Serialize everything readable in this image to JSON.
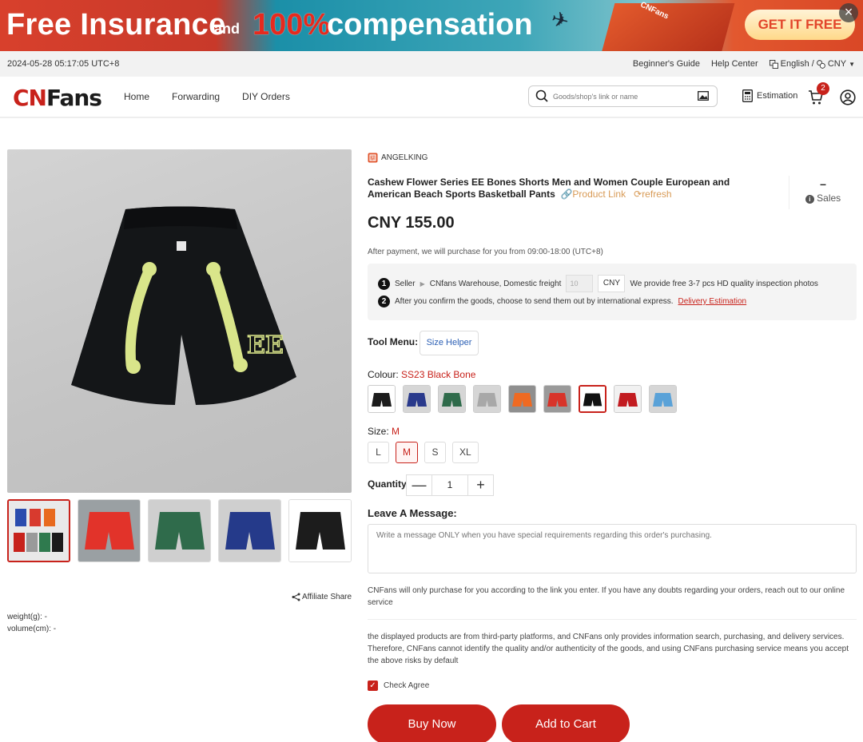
{
  "banner": {
    "text1": "Free Insurance",
    "text2": "and",
    "text3": "100%",
    "text4": "compensation",
    "box_text": "CNFans",
    "cta": "GET IT FREE",
    "close": "×"
  },
  "topbar": {
    "time": "2024-05-28 05:17:05 UTC+8",
    "guide": "Beginner's Guide",
    "help": "Help Center",
    "language": "English /",
    "currency": "CNY"
  },
  "header": {
    "logo_cn": "CN",
    "logo_fans": "Fans",
    "nav": [
      "Home",
      "Forwarding",
      "DIY Orders"
    ],
    "search_placeholder": "Goods/shop's link or name",
    "estimation": "Estimation",
    "cart_count": "2"
  },
  "product": {
    "seller": "ANGELKING",
    "title": "Cashew Flower Series EE Bones Shorts Men and Women Couple European and American Beach Sports Basketball Pants",
    "product_link": "Product Link",
    "refresh": "refresh",
    "sales_value": "–",
    "sales_label": "Sales",
    "price": "CNY 155.00",
    "after_payment": "After payment, we will purchase for you from 09:00-18:00 (UTC+8)",
    "affiliate": "Affiliate Share",
    "weight": "weight(g):  -",
    "volume": "volume(cm):  -"
  },
  "info": {
    "step1_num": "1",
    "seller_label": "Seller",
    "warehouse": "CNfans Warehouse, Domestic freight",
    "freight_placeholder": "10",
    "freight_currency": "CNY",
    "free_photos": "We provide free 3-7 pcs HD quality inspection photos",
    "step2_num": "2",
    "step2_text": "After you confirm the goods, choose to send them out by international express.",
    "delivery_link": "Delivery Estimation"
  },
  "options": {
    "tool_menu_label": "Tool Menu:",
    "size_helper": "Size Helper",
    "colour_label": "Colour:",
    "colour_value": "SS23 Black Bone",
    "size_label": "Size:",
    "size_value": "M",
    "sizes": [
      "L",
      "M",
      "S",
      "XL"
    ],
    "quantity_label": "Quantity",
    "quantity": "1",
    "minus": "—",
    "plus": "+"
  },
  "message": {
    "label": "Leave A Message:",
    "placeholder": "Write a message ONLY when you have special requirements regarding this order's purchasing.",
    "note1": "CNFans will only purchase for you according to the link you enter. If you have any doubts regarding your orders, reach out to our online service",
    "note2": "the displayed products are from third-party platforms, and CNFans only provides information search, purchasing, and delivery services. Therefore, CNFans cannot identify the quality and/or authenticity of the goods, and using CNFans purchasing service means you accept the above risks by default",
    "check_agree": "Check Agree",
    "check_mark": "✓"
  },
  "actions": {
    "buy_now": "Buy Now",
    "add_to_cart": "Add to Cart"
  },
  "colors": {
    "accent": "#c8221b",
    "link_gold": "#d89a55",
    "link_blue": "#2b5fb4"
  }
}
